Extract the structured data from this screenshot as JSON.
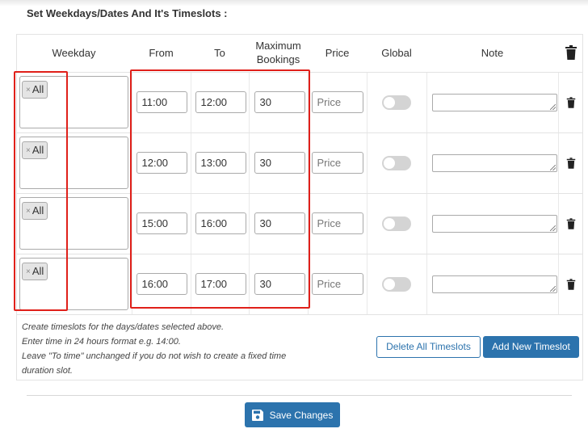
{
  "heading": "Set Weekdays/Dates And It's Timeslots :",
  "table": {
    "headers": {
      "weekday": "Weekday",
      "from": "From",
      "to": "To",
      "max_line1": "Maximum",
      "max_line2": "Bookings",
      "price": "Price",
      "global": "Global",
      "note": "Note",
      "delete_icon": "trash-icon"
    },
    "rows": [
      {
        "weekday_tag": "All",
        "from": "11:00",
        "to": "12:00",
        "max": "30",
        "price_placeholder": "Price",
        "global": false,
        "note": ""
      },
      {
        "weekday_tag": "All",
        "from": "12:00",
        "to": "13:00",
        "max": "30",
        "price_placeholder": "Price",
        "global": false,
        "note": ""
      },
      {
        "weekday_tag": "All",
        "from": "15:00",
        "to": "16:00",
        "max": "30",
        "price_placeholder": "Price",
        "global": false,
        "note": ""
      },
      {
        "weekday_tag": "All",
        "from": "16:00",
        "to": "17:00",
        "max": "30",
        "price_placeholder": "Price",
        "global": false,
        "note": ""
      }
    ],
    "tag_remove_glyph": "×"
  },
  "help": {
    "line1": "Create timeslots for the days/dates selected above.",
    "line2": "Enter time in 24 hours format e.g. 14:00.",
    "line3": "Leave \"To time\" unchanged if you do not wish to create a fixed time duration slot."
  },
  "buttons": {
    "delete_all": "Delete All Timeslots",
    "add_new": "Add New Timeslot",
    "save": "Save Changes"
  },
  "colors": {
    "accent": "#2c73ad",
    "highlight": "#e0201a",
    "toggle_off": "#d4d4d4"
  }
}
